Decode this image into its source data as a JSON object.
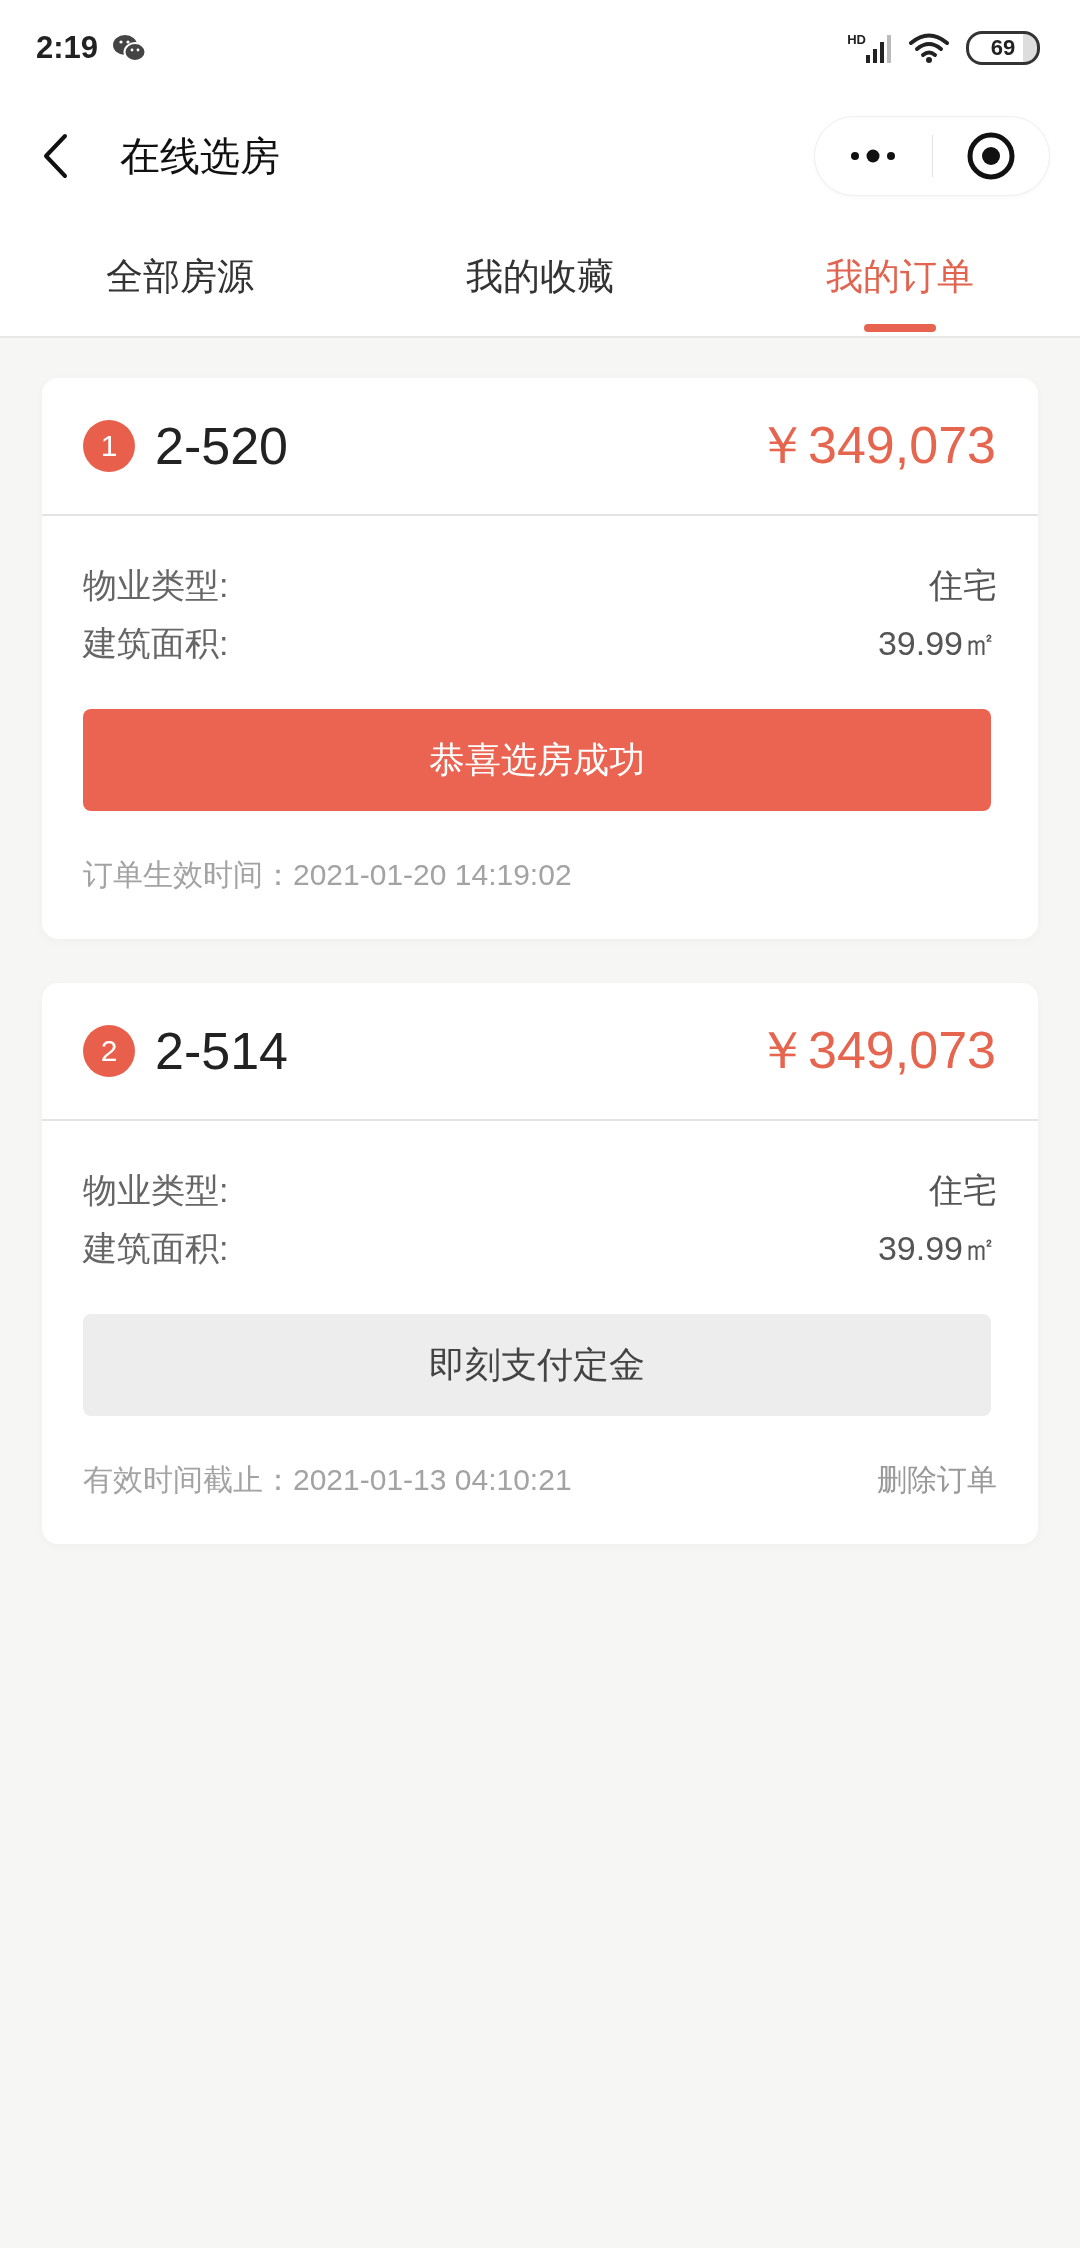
{
  "status_bar": {
    "time": "2:19",
    "network_type": "HD",
    "battery": "69"
  },
  "nav_bar": {
    "title": "在线选房"
  },
  "tabs": [
    {
      "label": "全部房源",
      "selected": false
    },
    {
      "label": "我的收藏",
      "selected": false
    },
    {
      "label": "我的订单",
      "selected": true
    }
  ],
  "orders": [
    {
      "number": "1",
      "unit": "2-520",
      "price": "￥349,073",
      "fields": [
        {
          "label": "物业类型:",
          "value": "住宅"
        },
        {
          "label": "建筑面积:",
          "value": "39.99㎡"
        }
      ],
      "action": {
        "kind": "success",
        "label": "恭喜选房成功"
      },
      "footer_text": "订单生效时间：2021-01-20 14:19:02"
    },
    {
      "number": "2",
      "unit": "2-514",
      "price": "￥349,073",
      "fields": [
        {
          "label": "物业类型:",
          "value": "住宅"
        },
        {
          "label": "建筑面积:",
          "value": "39.99㎡"
        }
      ],
      "action": {
        "kind": "pending",
        "label": "即刻支付定金"
      },
      "footer_text": "有效时间截止：2021-01-13 04:10:21",
      "delete_link": "删除订单"
    }
  ]
}
